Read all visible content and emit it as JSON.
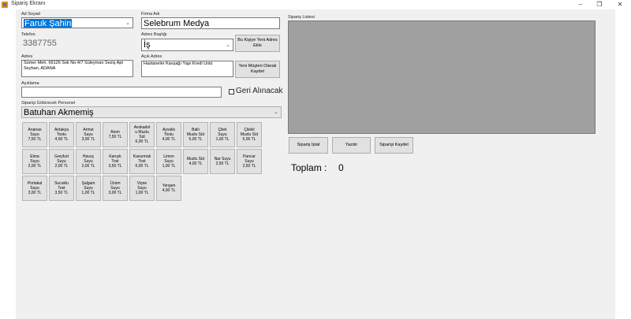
{
  "window": {
    "title": "Sipariş Ekranı",
    "minimize": "–",
    "maximize": "❐",
    "close": "✕",
    "icon": "app-form-icon"
  },
  "customer": {
    "name_label": "Ad Soyad",
    "name_value": "Faruk Şahin",
    "phone_label": "Telefon",
    "phone_value": "3387755",
    "address_label": "Adres",
    "address_value": "Sümer Meh. 69126 Sok No:4/7 Süleyman Seziş Apt Seyhan, ADANA"
  },
  "company": {
    "label": "Firma Adı",
    "value": "Selebrum Medya",
    "address_title_label": "Adres Başlığı",
    "address_title_value": "İş",
    "open_address_label": "Açık Adres",
    "open_address_value": "Hastaneler Kavşağı Yapı Kredi Üstü",
    "add_address_button": "Bu Kişiye Yeni Adres Ekle",
    "save_new_customer_button": "Yeni Müşteri Olarak Kaydet"
  },
  "notes": {
    "label": "Açıklama",
    "value": "",
    "return_checkbox_label": "Geri Alınacak",
    "return_checked": false
  },
  "staff": {
    "label": "Siparişi Götürecek Personel",
    "value": "Batuhan Akmemiş"
  },
  "products": [
    "Ananas\nSuyu\n7,50 TL",
    "Antakya\nTostu\n4,00 TL",
    "Armut\nSuyu\n3,00 TL",
    "Atom\n7,50 TL",
    "Avokadol\nu Muzlu\nSüt\n6,00 TL",
    "Ayvalık\nTostu\n4,00 TL",
    "Ballı\nMuzlu Süt\n5,00 TL",
    "Çilek\nSuyu\n1,00 TL",
    "Çilekli\nMuzlu Süt\n5,00 TL",
    "Elma\nSuyu\n2,00 TL",
    "Greyfurt\nSuyu\n2,00 TL",
    "Havuç\nSuyu\n2,00 TL",
    "Karışık\nTost\n3,50 TL",
    "Kavurmalı\nTost\n6,00 TL",
    "Limon\nSuyu\n1,00 TL",
    "Muzlu Süt\n4,00 TL",
    "Nar Suyu\n2,50 TL",
    "Pancar\nSuyu\n2,50 TL",
    "Portakal\nSuyu\n3,00 TL",
    "Sucuklu\nTost\n3,50 TL",
    "Şalgam\nSuyu\n1,00 TL",
    "Üzüm\nSuyu\n3,00 TL",
    "Vişne\nSuyu\n1,00 TL",
    "Yengen\n4,00 TL"
  ],
  "order": {
    "list_label": "Sipariş Listesi",
    "cancel_button": "Sipariş İptal",
    "print_button": "Yazdır",
    "save_button": "Siparişi Kaydet",
    "total_label": "Toplam :",
    "total_value": "0"
  }
}
